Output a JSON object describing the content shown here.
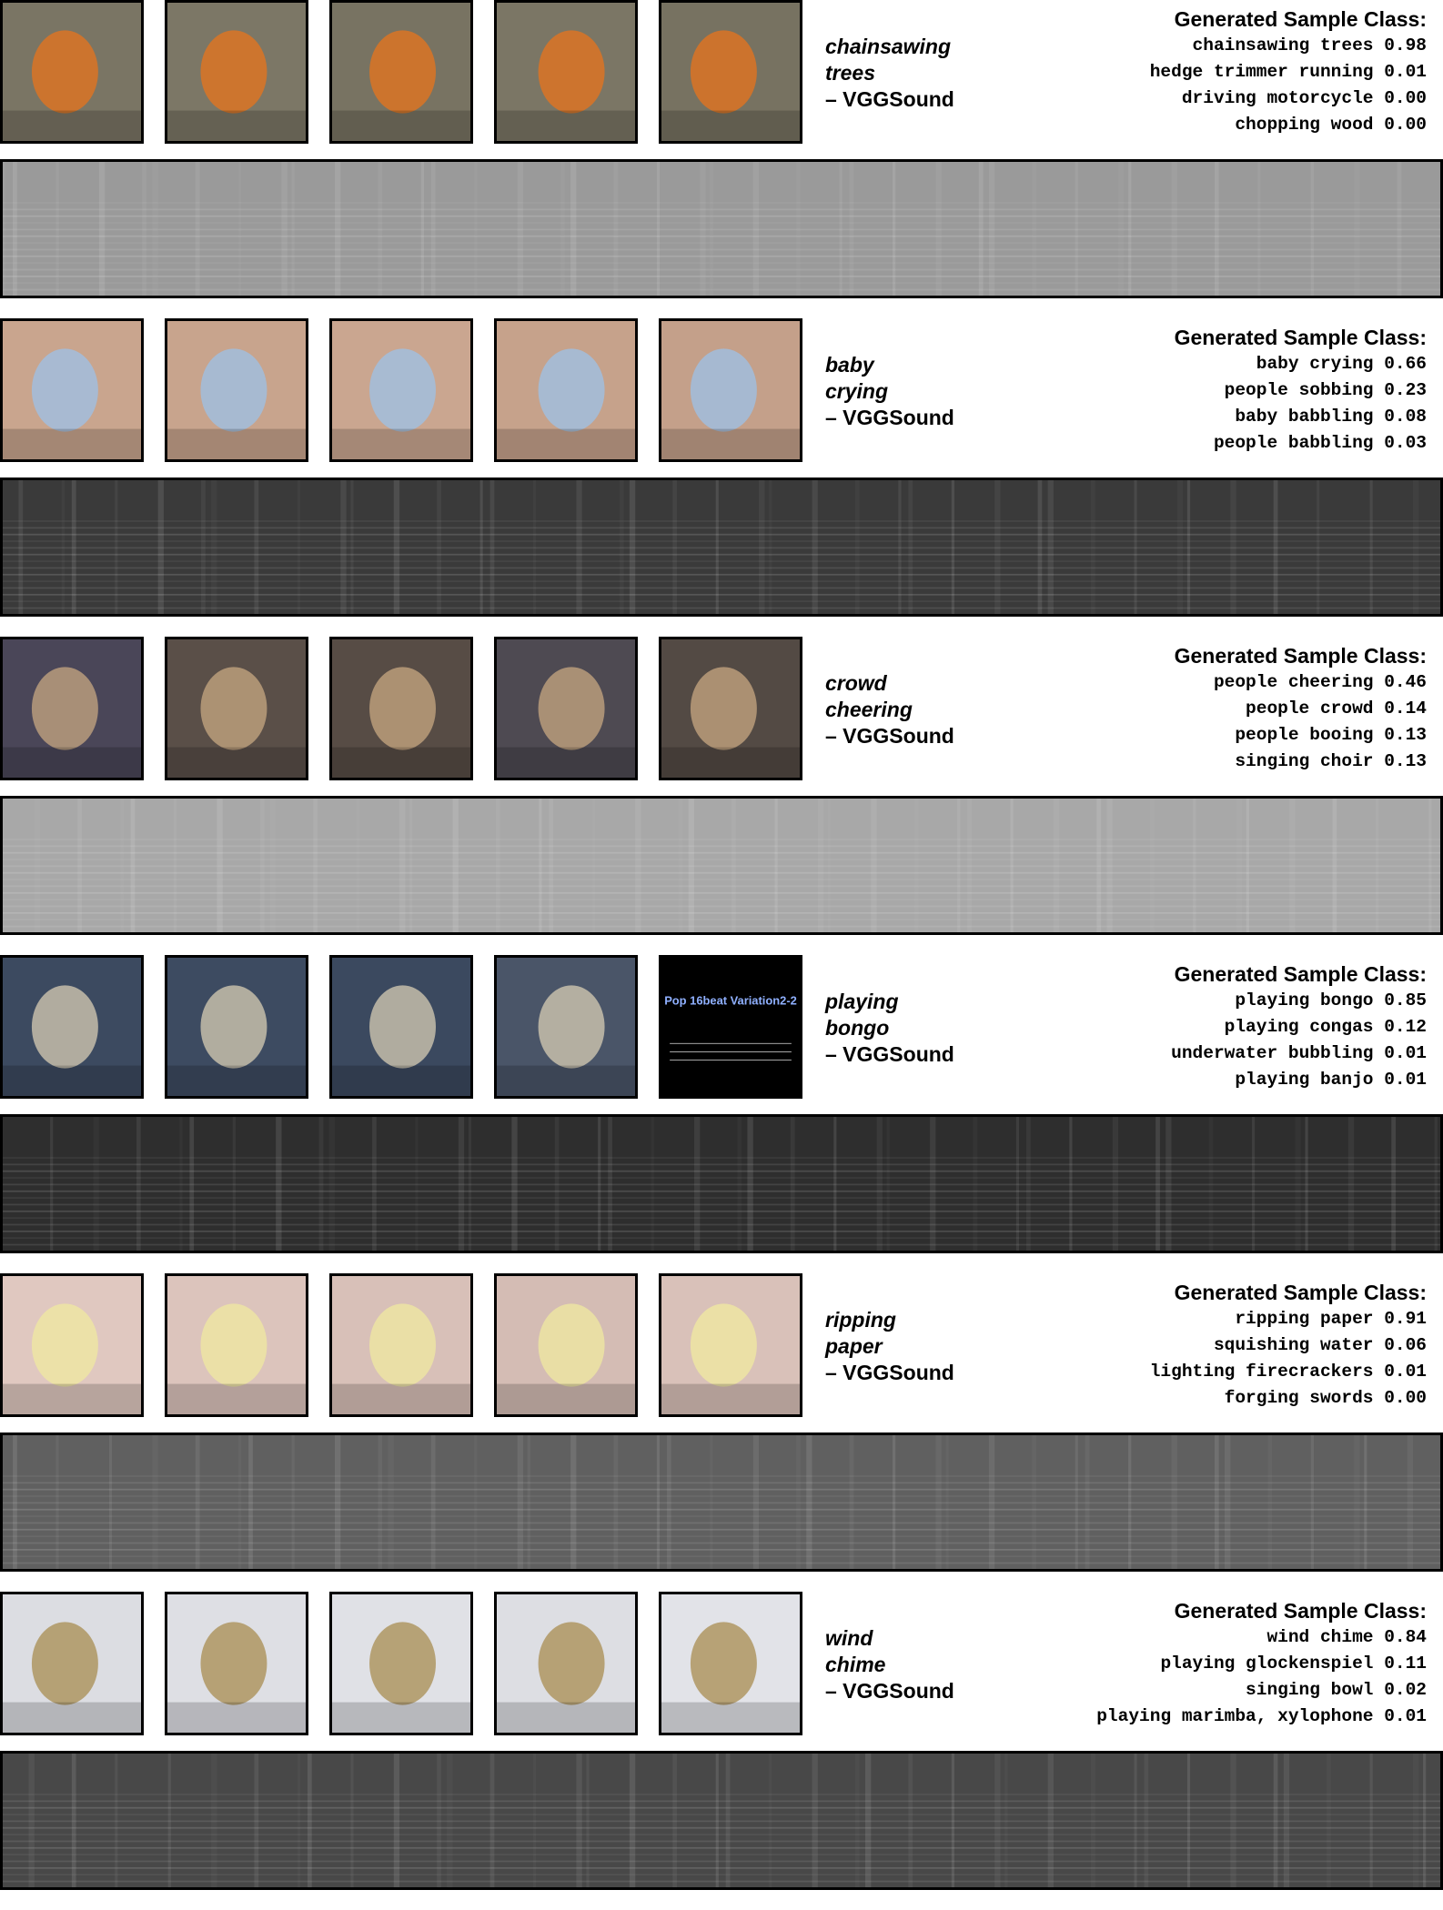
{
  "figure": {
    "header_label": "Generated Sample Class:",
    "dataset_suffix": "– VGGSound",
    "examples": [
      {
        "word1": "chainsawing",
        "word2": "trees",
        "predictions": [
          {
            "label": "chainsawing trees",
            "score": "0.98"
          },
          {
            "label": "hedge trimmer running",
            "score": "0.01"
          },
          {
            "label": "driving motorcycle",
            "score": "0.00"
          },
          {
            "label": "chopping wood",
            "score": "0.00"
          }
        ],
        "frame_colors": [
          "#7a7564",
          "#7c7766",
          "#787362",
          "#7b7665",
          "#777261"
        ],
        "frame_accent": "#e8741c",
        "spec_base": "#9a9a9a"
      },
      {
        "word1": "baby",
        "word2": "crying",
        "predictions": [
          {
            "label": "baby crying",
            "score": "0.66"
          },
          {
            "label": "people sobbing",
            "score": "0.23"
          },
          {
            "label": "baby babbling",
            "score": "0.08"
          },
          {
            "label": "people babbling",
            "score": "0.03"
          }
        ],
        "frame_colors": [
          "#c9a58e",
          "#c8a48d",
          "#caa690",
          "#c6a28b",
          "#c4a08a"
        ],
        "frame_accent": "#9cc2e8",
        "spec_base": "#3a3a3a"
      },
      {
        "word1": "crowd",
        "word2": "cheering",
        "predictions": [
          {
            "label": "people cheering",
            "score": "0.46"
          },
          {
            "label": "people crowd",
            "score": "0.14"
          },
          {
            "label": "people booing",
            "score": "0.13"
          },
          {
            "label": "singing choir",
            "score": "0.13"
          }
        ],
        "frame_colors": [
          "#4a4658",
          "#5a4f48",
          "#574c45",
          "#4e4a52",
          "#534a44"
        ],
        "frame_accent": "#c8a882",
        "spec_base": "#a8a8a8"
      },
      {
        "word1": "playing",
        "word2": "bongo",
        "predictions": [
          {
            "label": "playing bongo",
            "score": "0.85"
          },
          {
            "label": "playing congas",
            "score": "0.12"
          },
          {
            "label": "underwater bubbling",
            "score": "0.01"
          },
          {
            "label": "playing banjo",
            "score": "0.01"
          }
        ],
        "frame_colors": [
          "#3c4a60",
          "#3d4b61",
          "#3b495f",
          "#4a5568",
          "#000000"
        ],
        "frame_accent": "#d8cdb4",
        "frame5_text": "Pop 16beat Variation2-2",
        "spec_base": "#2e2e2e"
      },
      {
        "word1": "ripping",
        "word2": "paper",
        "predictions": [
          {
            "label": "ripping paper",
            "score": "0.91"
          },
          {
            "label": "squishing water",
            "score": "0.06"
          },
          {
            "label": "lighting firecrackers",
            "score": "0.01"
          },
          {
            "label": "forging swords",
            "score": "0.00"
          }
        ],
        "frame_colors": [
          "#e0c8c0",
          "#dcc4bc",
          "#d8c0b8",
          "#d4bcb4",
          "#d9c1b9"
        ],
        "frame_accent": "#f0eaa0",
        "spec_base": "#606060"
      },
      {
        "word1": "wind",
        "word2": "chime",
        "predictions": [
          {
            "label": "wind chime",
            "score": "0.84"
          },
          {
            "label": "playing glockenspiel",
            "score": "0.11"
          },
          {
            "label": "singing bowl",
            "score": "0.02"
          },
          {
            "label": "playing marimba, xylophone",
            "score": "0.01"
          }
        ],
        "frame_colors": [
          "#dcdde2",
          "#dedfe4",
          "#e0e1e6",
          "#dddee3",
          "#e2e3e8"
        ],
        "frame_accent": "#a88c50",
        "spec_base": "#484848"
      }
    ]
  }
}
